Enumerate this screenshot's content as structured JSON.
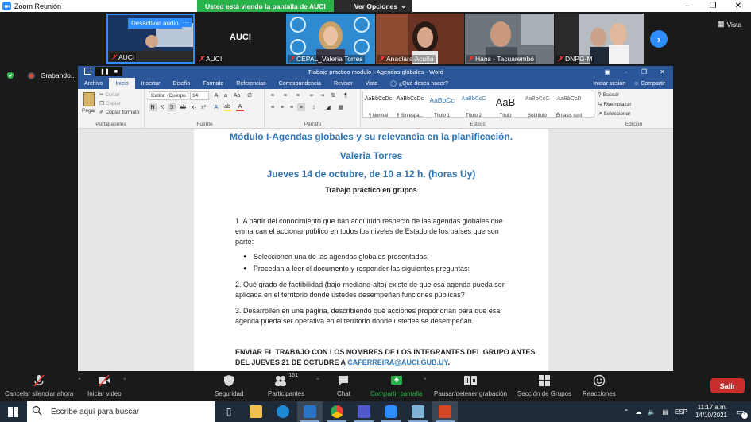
{
  "zoom": {
    "window_title": "Zoom Reunión",
    "share_banner": "Usted está viendo la pantalla de AUCI",
    "view_options": "Ver Opciones",
    "vista_label": "Vista",
    "recording_label": "Grabando...",
    "participants": [
      {
        "name": "AUCI",
        "tile_label": "Desactivar audio"
      },
      {
        "name": "AUCI",
        "big_label": "AUCI"
      },
      {
        "name": "CEPAL_Valeria Torres"
      },
      {
        "name": "Anaclara Acuña"
      },
      {
        "name": "Hans - Tacuarembó"
      },
      {
        "name": "DNPG-M"
      }
    ],
    "toolbar": {
      "unmute": "Cancelar silenciar ahora",
      "video": "Iniciar video",
      "security": "Seguridad",
      "participants": "Participantes",
      "participants_count": "161",
      "chat": "Chat",
      "share": "Compartir pantalla",
      "pause_share": "Pausar/detener grabación",
      "breakout": "Sección de Grupos",
      "reactions": "Reacciones",
      "leave": "Salir"
    }
  },
  "word": {
    "title": "Trabajo practico modulo I-Agendas globales - Word",
    "tabs": [
      "Archivo",
      "Inicio",
      "Insertar",
      "Diseño",
      "Formato",
      "Referencias",
      "Correspondencia",
      "Revisar",
      "Vista"
    ],
    "tell_me": "¿Qué desea hacer?",
    "signin": "Iniciar sesión",
    "share": "Compartir",
    "ribbon": {
      "paste": "Pegar",
      "cut": "Cortar",
      "copy": "Copiar",
      "format_painter": "Copiar formato",
      "clipboard_group": "Portapapeles",
      "font_name": "Calibri (Cuerpo",
      "font_size": "14",
      "font_group": "Fuente",
      "paragraph_group": "Párrafo",
      "styles_group": "Estilos",
      "styles": [
        {
          "sample": "AaBbCcDc",
          "name": "¶ Normal"
        },
        {
          "sample": "AaBbCcDc",
          "name": "¶ Sin espa..."
        },
        {
          "sample": "AaBbCc",
          "name": "Título 1"
        },
        {
          "sample": "AaBbCcC",
          "name": "Título 2"
        },
        {
          "sample": "AaB",
          "name": "Título"
        },
        {
          "sample": "AaBbCcC",
          "name": "Subtítulo"
        },
        {
          "sample": "AaBbCcD",
          "name": "Énfasis sutil"
        }
      ],
      "find": "Buscar",
      "replace": "Reemplazar",
      "select": "Seleccionar",
      "edit_group": "Edición"
    },
    "document": {
      "heading1": "Módulo I-Agendas globales y su relevancia en la planificación.",
      "heading2": "Valeria Torres",
      "heading3": "Jueves 14 de octubre, de 10 a 12 h. (horas Uy)",
      "subtitle": "Trabajo práctico en grupos",
      "p1": "1. A partir del conocimiento que han adquirido respecto de las agendas globales que enmarcan el accionar público en todos los niveles de Estado de los países que son parte:",
      "bullet1": "Seleccionen una de las agendas globales presentadas,",
      "bullet2": "Procedan a leer el documento y responder las siguientes preguntas:",
      "p2": "2.  Qué grado de factibilidad (bajo-mediano-alto) existe de que esa agenda pueda ser aplicada en el territorio donde ustedes desempeñan funciones públicas?",
      "p3": "3. Desarrollen en una página, describiendo qué acciones propondrían para que esa agenda pueda ser operativa en el territorio donde ustedes se desempeñan.",
      "p4_line1": "ENVIAR EL TRABAJO CON LOS NOMBRES DE LOS INTEGRANTES DEL GRUPO ANTES",
      "p4_line2_prefix": "DEL JUEVES 21 DE OCTUBRE A ",
      "p4_email": "CAFERREIRA@AUCI.GUB.UY",
      "p4_suffix": "."
    }
  },
  "taskbar": {
    "search_placeholder": "Escribe aquí para buscar",
    "language": "ESP",
    "time": "11:17 a.m.",
    "date": "14/10/2021",
    "notifications": "1"
  }
}
